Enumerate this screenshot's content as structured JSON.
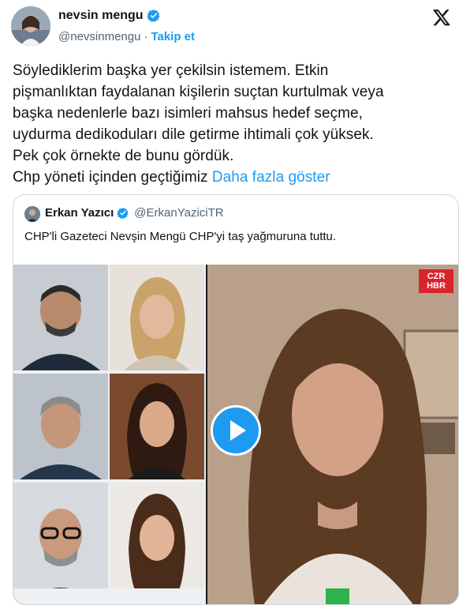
{
  "author": {
    "display_name": "nevsin mengu",
    "handle": "@nevsinmengu",
    "separator": "·",
    "follow_label": "Takip et"
  },
  "tweet": {
    "lines": [
      "Söylediklerim başka yer çekilsin istemem. Etkin",
      "pişmanlıktan faydalanan kişilerin suçtan kurtulmak veya",
      "başka nedenlerle bazı isimleri mahsus hedef seçme,",
      "uydurma dedikoduları dile getirme ihtimali çok yüksek.",
      "Pek çok örnekte de bunu gördük."
    ],
    "last_line": "Chp yöneti içinden geçtiğimiz ",
    "show_more_label": "Daha fazla göster"
  },
  "quote": {
    "display_name": "Erkan Yazıcı",
    "handle": "@ErkanYaziciTR",
    "text": "CHP'li Gazeteci Nevşin Mengü CHP'yi taş yağmuruna tuttu."
  },
  "media": {
    "badge_top": "CZR",
    "badge_bottom": "HBR"
  },
  "colors": {
    "link": "#1d9bf0",
    "verified": "#1d9bf0",
    "text": "#0f1419",
    "muted": "#536471",
    "badge": "#d8242b"
  },
  "icons": {
    "verified": "verified-badge-icon",
    "logo": "x-logo-icon",
    "play": "play-icon"
  }
}
